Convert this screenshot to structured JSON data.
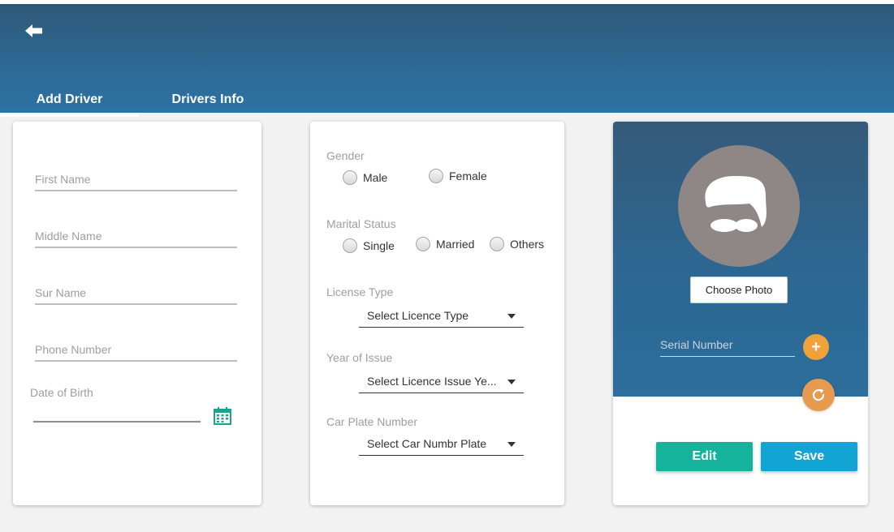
{
  "colors": {
    "header": "#2e6a96",
    "edit": "#15b39b",
    "save": "#12a4d3",
    "accent_orange": "#f0a23a"
  },
  "tabs": [
    {
      "label": "Add Driver",
      "active": true
    },
    {
      "label": "Drivers Info",
      "active": false
    }
  ],
  "personal": {
    "first_name_placeholder": "First Name",
    "middle_name_placeholder": "Middle Name",
    "sur_name_placeholder": "Sur Name",
    "phone_placeholder": "Phone Number",
    "dob_label": "Date of Birth"
  },
  "details": {
    "gender_label": "Gender",
    "gender_options": [
      "Male",
      "Female"
    ],
    "marital_label": "Marital Status",
    "marital_options": [
      "Single",
      "Married",
      "Others"
    ],
    "license_type_label": "License Type",
    "license_type_value": "Select Licence Type",
    "year_label": "Year of Issue",
    "year_value": "Select Licence Issue Ye...",
    "plate_label": "Car Plate Number",
    "plate_value": "Select Car Numbr Plate"
  },
  "photo": {
    "choose_label": "Choose Photo",
    "serial_placeholder": "Serial Number",
    "add_symbol": "+"
  },
  "actions": {
    "edit_label": "Edit",
    "save_label": "Save"
  },
  "icons": [
    "back-arrow-icon",
    "calendar-icon",
    "avatar-icon",
    "plus-icon",
    "refresh-icon",
    "chevron-down-icon"
  ]
}
